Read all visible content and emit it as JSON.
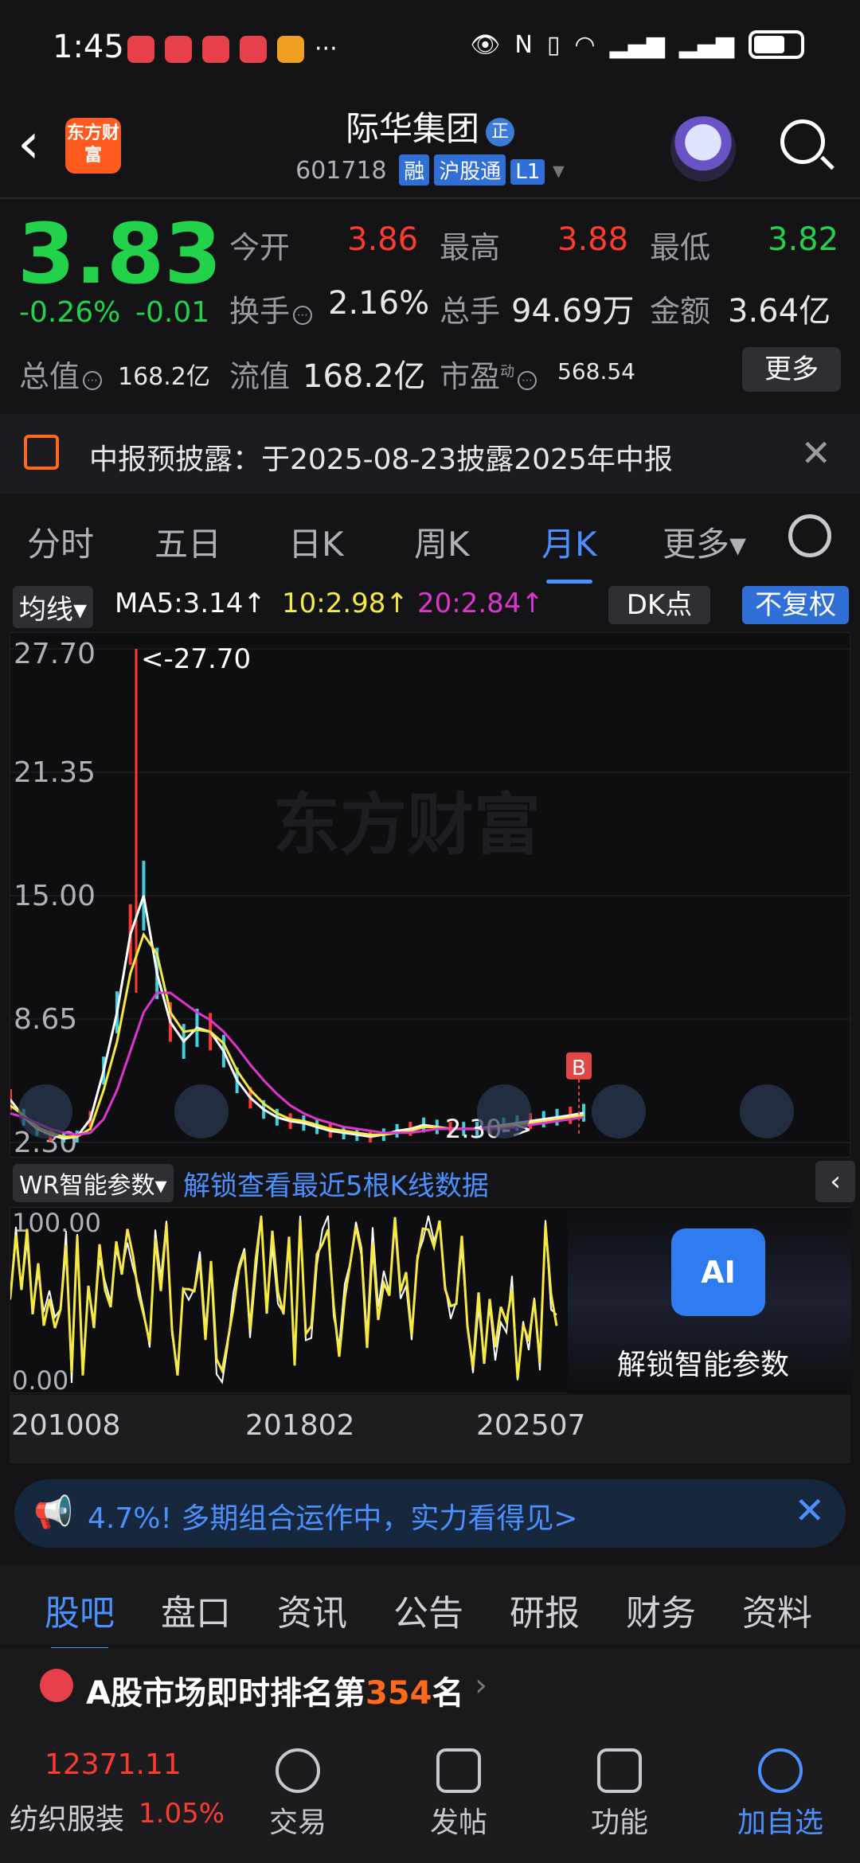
{
  "status": {
    "time": "1:45",
    "more": "···"
  },
  "header": {
    "logo": "东方财富",
    "title": "际华集团",
    "title_tag": "正",
    "code": "601718",
    "badges": [
      "融",
      "沪股通",
      "L1"
    ]
  },
  "quote": {
    "price": "3.83",
    "change_pct": "-0.26%",
    "change": "-0.01",
    "open_label": "今开",
    "open": "3.86",
    "high_label": "最高",
    "high": "3.88",
    "low_label": "最低",
    "low": "3.82",
    "turnover_label": "换手",
    "turnover": "2.16%",
    "volume_label": "总手",
    "volume": "94.69万",
    "amount_label": "金额",
    "amount": "3.64亿",
    "mktcap_label": "总值",
    "mktcap": "168.2亿",
    "float_label": "流值",
    "float": "168.2亿",
    "pe_label": "市盈",
    "pe_sup": "动",
    "pe": "568.54",
    "more": "更多"
  },
  "notice": {
    "text": "中报预披露：于2025-08-23披露2025年中报"
  },
  "tabs": {
    "items": [
      "分时",
      "五日",
      "日K",
      "周K",
      "月K",
      "更多▾"
    ],
    "active": 4
  },
  "ma": {
    "select": "均线▾",
    "ma5": "MA5:3.14↑",
    "ma10": "10:2.98↑",
    "ma20": "20:2.84↑",
    "dk": "DK点",
    "fq": "不复权"
  },
  "chart_data": {
    "type": "line",
    "title": "",
    "y_ticks": [
      "27.70",
      "21.35",
      "15.00",
      "8.65",
      "2.30"
    ],
    "ylim": [
      2.3,
      27.7
    ],
    "annotations": [
      "<-27.70",
      "2.30->",
      "B"
    ],
    "x_ticks": [
      "201008",
      "201802",
      "202507"
    ],
    "watermark": "东方财富",
    "series": [
      {
        "color": "#ffffff",
        "values": [
          4.5,
          3.6,
          3.0,
          2.7,
          2.5,
          2.6,
          3.5,
          6,
          9,
          13,
          15,
          11,
          8.5,
          7.5,
          8.2,
          8.0,
          7.0,
          5.5,
          4.6,
          4.0,
          3.6,
          3.4,
          3.3,
          3.1,
          2.9,
          2.8,
          2.7,
          2.6,
          2.7,
          2.9,
          3.0,
          3.2,
          3.1,
          3.0,
          3.0,
          3.0,
          3.1,
          3.2,
          3.3,
          3.4,
          3.5,
          3.6,
          3.7,
          3.83
        ]
      },
      {
        "color": "#f5e942",
        "values": [
          4.2,
          3.7,
          3.1,
          2.8,
          2.6,
          2.6,
          3.0,
          5,
          7.5,
          11,
          13,
          12,
          9,
          8,
          8.1,
          8.0,
          7.4,
          6.0,
          5.0,
          4.3,
          3.8,
          3.5,
          3.4,
          3.2,
          3.0,
          2.9,
          2.8,
          2.7,
          2.7,
          2.8,
          2.9,
          3.1,
          3.1,
          3.0,
          3.0,
          3.0,
          3.0,
          3.1,
          3.2,
          3.3,
          3.4,
          3.5,
          3.6,
          3.7
        ]
      },
      {
        "color": "#e034d0",
        "values": [
          3.8,
          3.6,
          3.3,
          3.0,
          2.8,
          2.7,
          2.8,
          3.5,
          5,
          7,
          9,
          10,
          10,
          9.5,
          9,
          8.6,
          8.0,
          7.2,
          6.3,
          5.5,
          4.8,
          4.2,
          3.8,
          3.5,
          3.3,
          3.1,
          3.0,
          2.9,
          2.8,
          2.8,
          2.8,
          2.9,
          3.0,
          3.0,
          3.0,
          3.0,
          3.0,
          3.0,
          3.1,
          3.2,
          3.3,
          3.4,
          3.5,
          3.6
        ]
      }
    ]
  },
  "wr": {
    "select": "WR智能参数▾",
    "unlock": "解锁查看最近5根K线数据",
    "top": "100.00",
    "bottom": "0.00",
    "ai_label": "AI",
    "ai_text": "解锁智能参数"
  },
  "ad": {
    "text": "4.7%!  多期组合运作中，实力看得见>"
  },
  "btabs": {
    "items": [
      "股吧",
      "盘口",
      "资讯",
      "公告",
      "研报",
      "财务",
      "资料"
    ],
    "active": 0
  },
  "rank": {
    "prefix": "A股市场即时排名第",
    "num": "354",
    "suffix": "名"
  },
  "nav": {
    "index_value": "12371.11",
    "sector": "纺织服装",
    "sector_pct": "1.05%",
    "items": [
      "交易",
      "发帖",
      "功能",
      "加自选"
    ]
  }
}
